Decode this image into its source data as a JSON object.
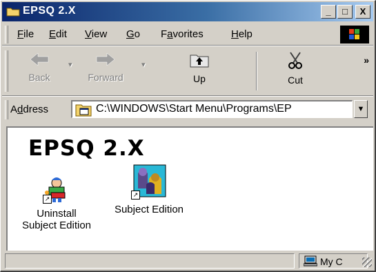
{
  "window": {
    "title": "EPSQ 2.X",
    "controls": {
      "minimize": "_",
      "maximize": "□",
      "close": "X"
    }
  },
  "menubar": {
    "items": [
      {
        "label": "File",
        "key": "F",
        "rest": "ile"
      },
      {
        "label": "Edit",
        "key": "E",
        "rest": "dit"
      },
      {
        "label": "View",
        "key": "V",
        "rest": "iew"
      },
      {
        "label": "Go",
        "key": "G",
        "rest": "o"
      },
      {
        "label": "Favorites",
        "pre": "F",
        "key": "a",
        "rest": "vorites"
      },
      {
        "label": "Help",
        "key": "H",
        "rest": "elp"
      }
    ]
  },
  "toolbar": {
    "back_label": "Back",
    "forward_label": "Forward",
    "up_label": "Up",
    "cut_label": "Cut",
    "more": "»"
  },
  "address": {
    "label_pre": "A",
    "label_key": "d",
    "label_rest": "dress",
    "value": "C:\\WINDOWS\\Start Menu\\Programs\\EP",
    "dropdown": "▼"
  },
  "content": {
    "folder_title": "EPSQ 2.X",
    "items": [
      {
        "line1": "Uninstall",
        "line2": "Subject Edition",
        "icon": "uninstall-shortcut-icon"
      },
      {
        "line1": "Subject Edition",
        "line2": "",
        "icon": "subject-edition-shortcut-icon"
      }
    ]
  },
  "statusbar": {
    "zone_text": "My C"
  },
  "colors": {
    "title_start": "#0a246a",
    "title_end": "#a6caf0",
    "face": "#d4d0c8"
  }
}
